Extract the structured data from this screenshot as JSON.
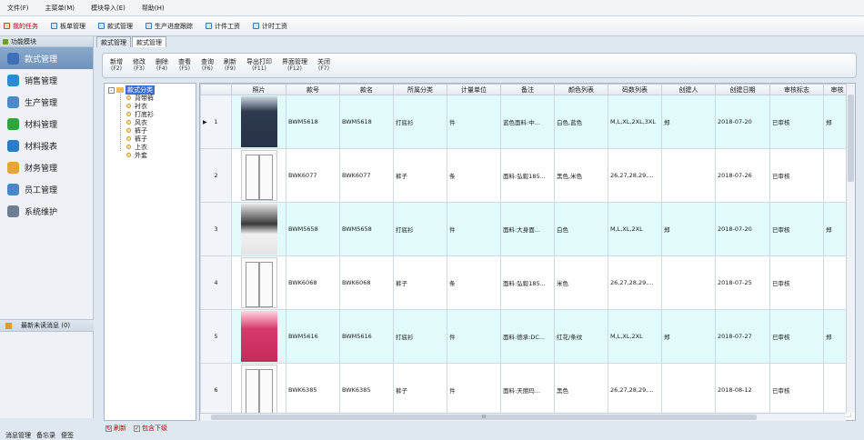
{
  "menu": [
    "文件(F)",
    "主菜单(M)",
    "模块导入(E)",
    "帮助(H)"
  ],
  "shortcuts": [
    "我的任务",
    "板单管理",
    "款式管理",
    "生产进度跟踪",
    "计件工资",
    "计时工资"
  ],
  "sidebar": {
    "header": "功能模块",
    "items": [
      "款式管理",
      "销售管理",
      "生产管理",
      "材料管理",
      "材料报表",
      "财务管理",
      "员工管理",
      "系统维护"
    ],
    "icon_colors": [
      "#3e6fb8",
      "#2b8ad1",
      "#4c89c9",
      "#2ea43a",
      "#2a7cc7",
      "#e8a33a",
      "#4a86c8",
      "#6e7f94"
    ],
    "unread": "最新未读消息 (0)"
  },
  "bottom_nav": [
    "消息管理",
    "备忘录",
    "便签"
  ],
  "tabs": [
    "款式管理",
    "款式管理"
  ],
  "toolbar": [
    {
      "label": "新增",
      "key": "(F2)"
    },
    {
      "label": "修改",
      "key": "(F3)"
    },
    {
      "label": "删除",
      "key": "(F4)"
    },
    {
      "label": "查看",
      "key": "(F5)"
    },
    {
      "label": "查询",
      "key": "(F6)"
    },
    {
      "label": "刷新",
      "key": "(F9)"
    },
    {
      "label": "导出打印",
      "key": "(F11)"
    },
    {
      "label": "界面管理",
      "key": "(F12)"
    },
    {
      "label": "关闭",
      "key": "(F7)"
    }
  ],
  "tree": {
    "root": "款式分类",
    "nodes": [
      "背带裤",
      "衬衣",
      "打底衫",
      "风衣",
      "裤子",
      "裤子",
      "上衣",
      "外套"
    ]
  },
  "tree_footer": {
    "refresh": "刷新",
    "include": "包含下级"
  },
  "table": {
    "headers": [
      "",
      "照片",
      "款号",
      "款名",
      "所属分类",
      "计量单位",
      "备注",
      "颜色列表",
      "码数列表",
      "创建人",
      "创建日期",
      "审核标志",
      "审核"
    ],
    "rows": [
      {
        "no": "1",
        "code": "BWM5618",
        "name": "BWM5618",
        "cat": "打底衫",
        "unit": "件",
        "note": "蓝色面料:中...",
        "colors": "白色,蓝色",
        "sizes": "M,L,XL,2XL,3XL",
        "creator": "郑",
        "date": "2018-07-20",
        "audit": "已审核",
        "auditor": "郑"
      },
      {
        "no": "2",
        "code": "BWK6077",
        "name": "BWK6077",
        "cat": "裤子",
        "unit": "条",
        "note": "面料:弘毅185...",
        "colors": "黑色,米色",
        "sizes": "26,27,28,29,...",
        "creator": "",
        "date": "2018-07-26",
        "audit": "已审核",
        "auditor": ""
      },
      {
        "no": "3",
        "code": "BWM5658",
        "name": "BWM5658",
        "cat": "打底衫",
        "unit": "件",
        "note": "面料:大身面...",
        "colors": "白色",
        "sizes": "M,L,XL,2XL",
        "creator": "郑",
        "date": "2018-07-20",
        "audit": "已审核",
        "auditor": "郑"
      },
      {
        "no": "4",
        "code": "BWK6068",
        "name": "BWK6068",
        "cat": "裤子",
        "unit": "条",
        "note": "面料:弘毅185...",
        "colors": "米色",
        "sizes": "26,27,28,29,...",
        "creator": "",
        "date": "2018-07-25",
        "audit": "已审核",
        "auditor": ""
      },
      {
        "no": "5",
        "code": "BWM5616",
        "name": "BWM5616",
        "cat": "打底衫",
        "unit": "件",
        "note": "面料:德承:DC...",
        "colors": "红花/条纹",
        "sizes": "M,L,XL,2XL",
        "creator": "郑",
        "date": "2018-07-27",
        "audit": "已审核",
        "auditor": "郑"
      },
      {
        "no": "6",
        "code": "BWK6385",
        "name": "BWK6385",
        "cat": "裤子",
        "unit": "件",
        "note": "面料:天丽玛...",
        "colors": "黑色",
        "sizes": "26,27,28,29,...",
        "creator": "",
        "date": "2018-08-12",
        "audit": "已审核",
        "auditor": ""
      }
    ],
    "photos": [
      "ph-dark",
      "ph-pants",
      "ph-hoodie",
      "ph-pants",
      "ph-pink",
      "ph-pants"
    ]
  },
  "scroll_grip": "III"
}
